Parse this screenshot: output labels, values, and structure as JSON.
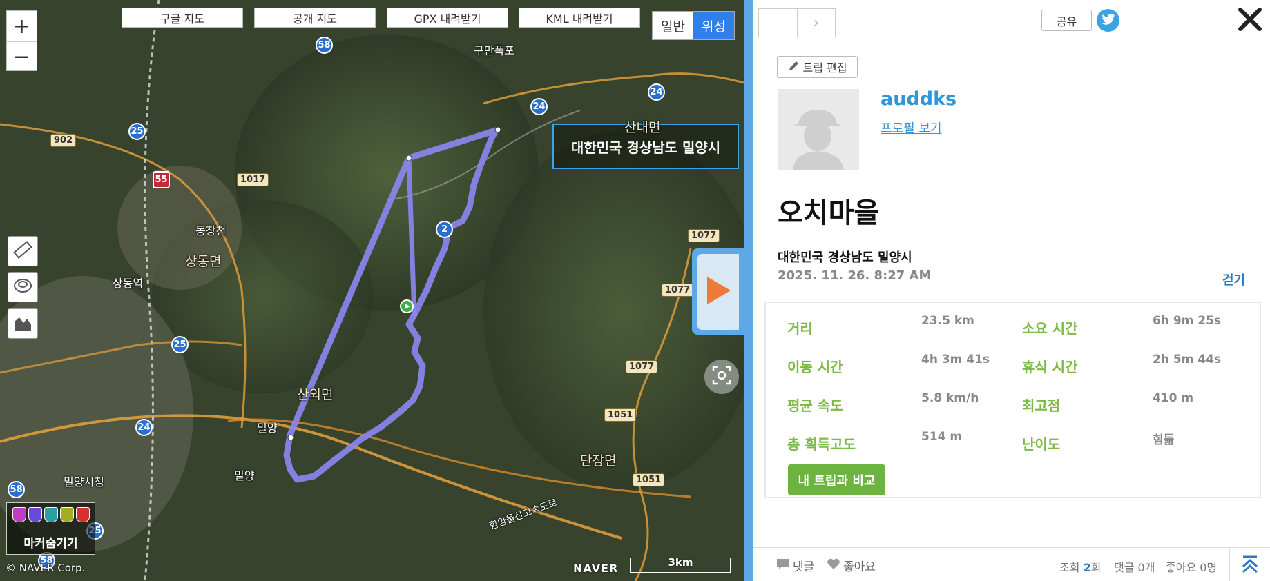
{
  "map": {
    "maptype_buttons": [
      "구글 지도",
      "공개 지도",
      "GPX 내려받기",
      "KML 내려받기"
    ],
    "zoom_in": "+",
    "zoom_out": "−",
    "view_normal": "일반",
    "view_satellite": "위성",
    "address_box": "대한민국 경상남도 밀양시",
    "labels": {
      "waterfall": "구만폭포",
      "sannae": "산내면",
      "dongchangcheon": "동창천",
      "sangdong": "상동면",
      "sangdong_station": "상동역",
      "sanoe": "산외면",
      "miryang_jc": "밀양",
      "miryang_ic": "밀양",
      "miryang_city_hall": "밀양시청",
      "danjang": "단장면",
      "expressway": "함양울산고속도로"
    },
    "road_numbers": {
      "r58a": "58",
      "r25a": "25",
      "r902": "902",
      "r55": "55",
      "r1017": "1017",
      "r24a": "24",
      "r24b": "24",
      "r1077a": "1077",
      "r1077b": "1077",
      "r1077c": "1077",
      "r25b": "25",
      "r24c": "24",
      "r1051a": "1051",
      "r1051b": "1051",
      "r58b": "58",
      "r25c": "25",
      "r58c": "58",
      "r2": "2"
    },
    "marker_hide_label": "마커숨기기",
    "copyright": "© NAVER Corp.",
    "brand": "NAVER",
    "scale_label": "3km",
    "route_color": "#8a86f0",
    "marker_colors": [
      "#c03cc0",
      "#6a4ad8",
      "#2aa0a0",
      "#a0b020",
      "#d83030"
    ]
  },
  "panel": {
    "share_label": "공유",
    "edit_label": "트립 편집",
    "username": "auddks",
    "profile_link": "프로필 보기",
    "trip_title": "오치마을",
    "trip_address": "대한민국 경상남도 밀양시",
    "trip_date": "2025. 11. 26. 8:27 AM",
    "activity": "걷기",
    "stats": {
      "distance_label": "거리",
      "distance": "23.5 km",
      "duration_label": "소요 시간",
      "duration": "6h 9m 25s",
      "moving_label": "이동 시간",
      "moving": "4h 3m 41s",
      "rest_label": "휴식 시간",
      "rest": "2h 5m 44s",
      "avg_speed_label": "평균 속도",
      "avg_speed": "5.8 km/h",
      "max_elev_label": "최고점",
      "max_elev": "410 m",
      "gain_label": "총 획득고도",
      "gain": "514 m",
      "difficulty_label": "난이도",
      "difficulty": "힘듦"
    },
    "compare_label": "내 트립과 비교",
    "footer": {
      "comment_label": "댓글",
      "like_label": "좋아요",
      "views_prefix": "조회 ",
      "views": "2",
      "views_suffix": "회",
      "comments_count": "댓글 0개",
      "likes_count": "좋아요 0명"
    },
    "accent_color": "#2f96d8",
    "stat_label_color": "#7db945"
  }
}
